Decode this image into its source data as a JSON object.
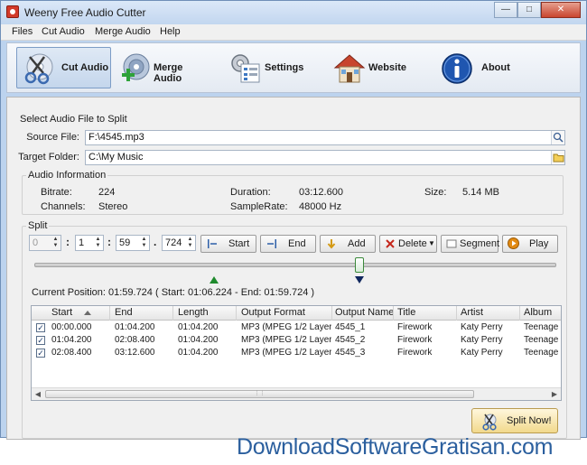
{
  "window": {
    "title": "Weeny Free Audio Cutter"
  },
  "menu": [
    "Files",
    "Cut Audio",
    "Merge Audio",
    "Help"
  ],
  "toolbar": [
    {
      "label": "Cut Audio",
      "icon": "scissors-cd-icon",
      "active": true
    },
    {
      "label": "Merge Audio",
      "icon": "merge-cd-icon",
      "active": false
    },
    {
      "label": "Settings",
      "icon": "settings-gear-icon",
      "active": false
    },
    {
      "label": "Website",
      "icon": "house-icon",
      "active": false
    },
    {
      "label": "About",
      "icon": "info-icon",
      "active": false
    }
  ],
  "select_file": {
    "title": "Select Audio File to Split",
    "source_label": "Source File:",
    "source_value": "F:\\4545.mp3",
    "target_label": "Target Folder:",
    "target_value": "C:\\My Music"
  },
  "audio_info": {
    "title": "Audio Information",
    "bitrate_label": "Bitrate:",
    "bitrate_value": "224",
    "duration_label": "Duration:",
    "duration_value": "03:12.600",
    "size_label": "Size:",
    "size_value": "5.14 MB",
    "channels_label": "Channels:",
    "channels_value": "Stereo",
    "samplerate_label": "SampleRate:",
    "samplerate_value": "48000 Hz"
  },
  "split": {
    "title": "Split",
    "hours": "0",
    "minutes": "1",
    "seconds": "59",
    "millis": "724",
    "buttons": {
      "start": "Start",
      "end": "End",
      "add": "Add",
      "delete": "Delete",
      "segment": "Segment",
      "play": "Play"
    },
    "position_text": "Current Position: 01:59.724 ( Start: 01:06.224 - End: 01:59.724 )",
    "slider_fraction": 0.623,
    "start_marker_fraction": 0.344,
    "end_marker_fraction": 0.623
  },
  "table": {
    "headers": [
      "Start",
      "End",
      "Length",
      "Output Format",
      "Output Name",
      "Title",
      "Artist",
      "Album"
    ],
    "rows": [
      [
        "00:00.000",
        "01:04.200",
        "01:04.200",
        "MP3 (MPEG 1/2 Layer 3)",
        "4545_1",
        "Firework",
        "Katy Perry",
        "Teenage D"
      ],
      [
        "01:04.200",
        "02:08.400",
        "01:04.200",
        "MP3 (MPEG 1/2 Layer 3)",
        "4545_2",
        "Firework",
        "Katy Perry",
        "Teenage D"
      ],
      [
        "02:08.400",
        "03:12.600",
        "01:04.200",
        "MP3 (MPEG 1/2 Layer 3)",
        "4545_3",
        "Firework",
        "Katy Perry",
        "Teenage D"
      ]
    ]
  },
  "split_now": "Split Now!",
  "watermark": "DownloadSoftwareGratisan.com"
}
